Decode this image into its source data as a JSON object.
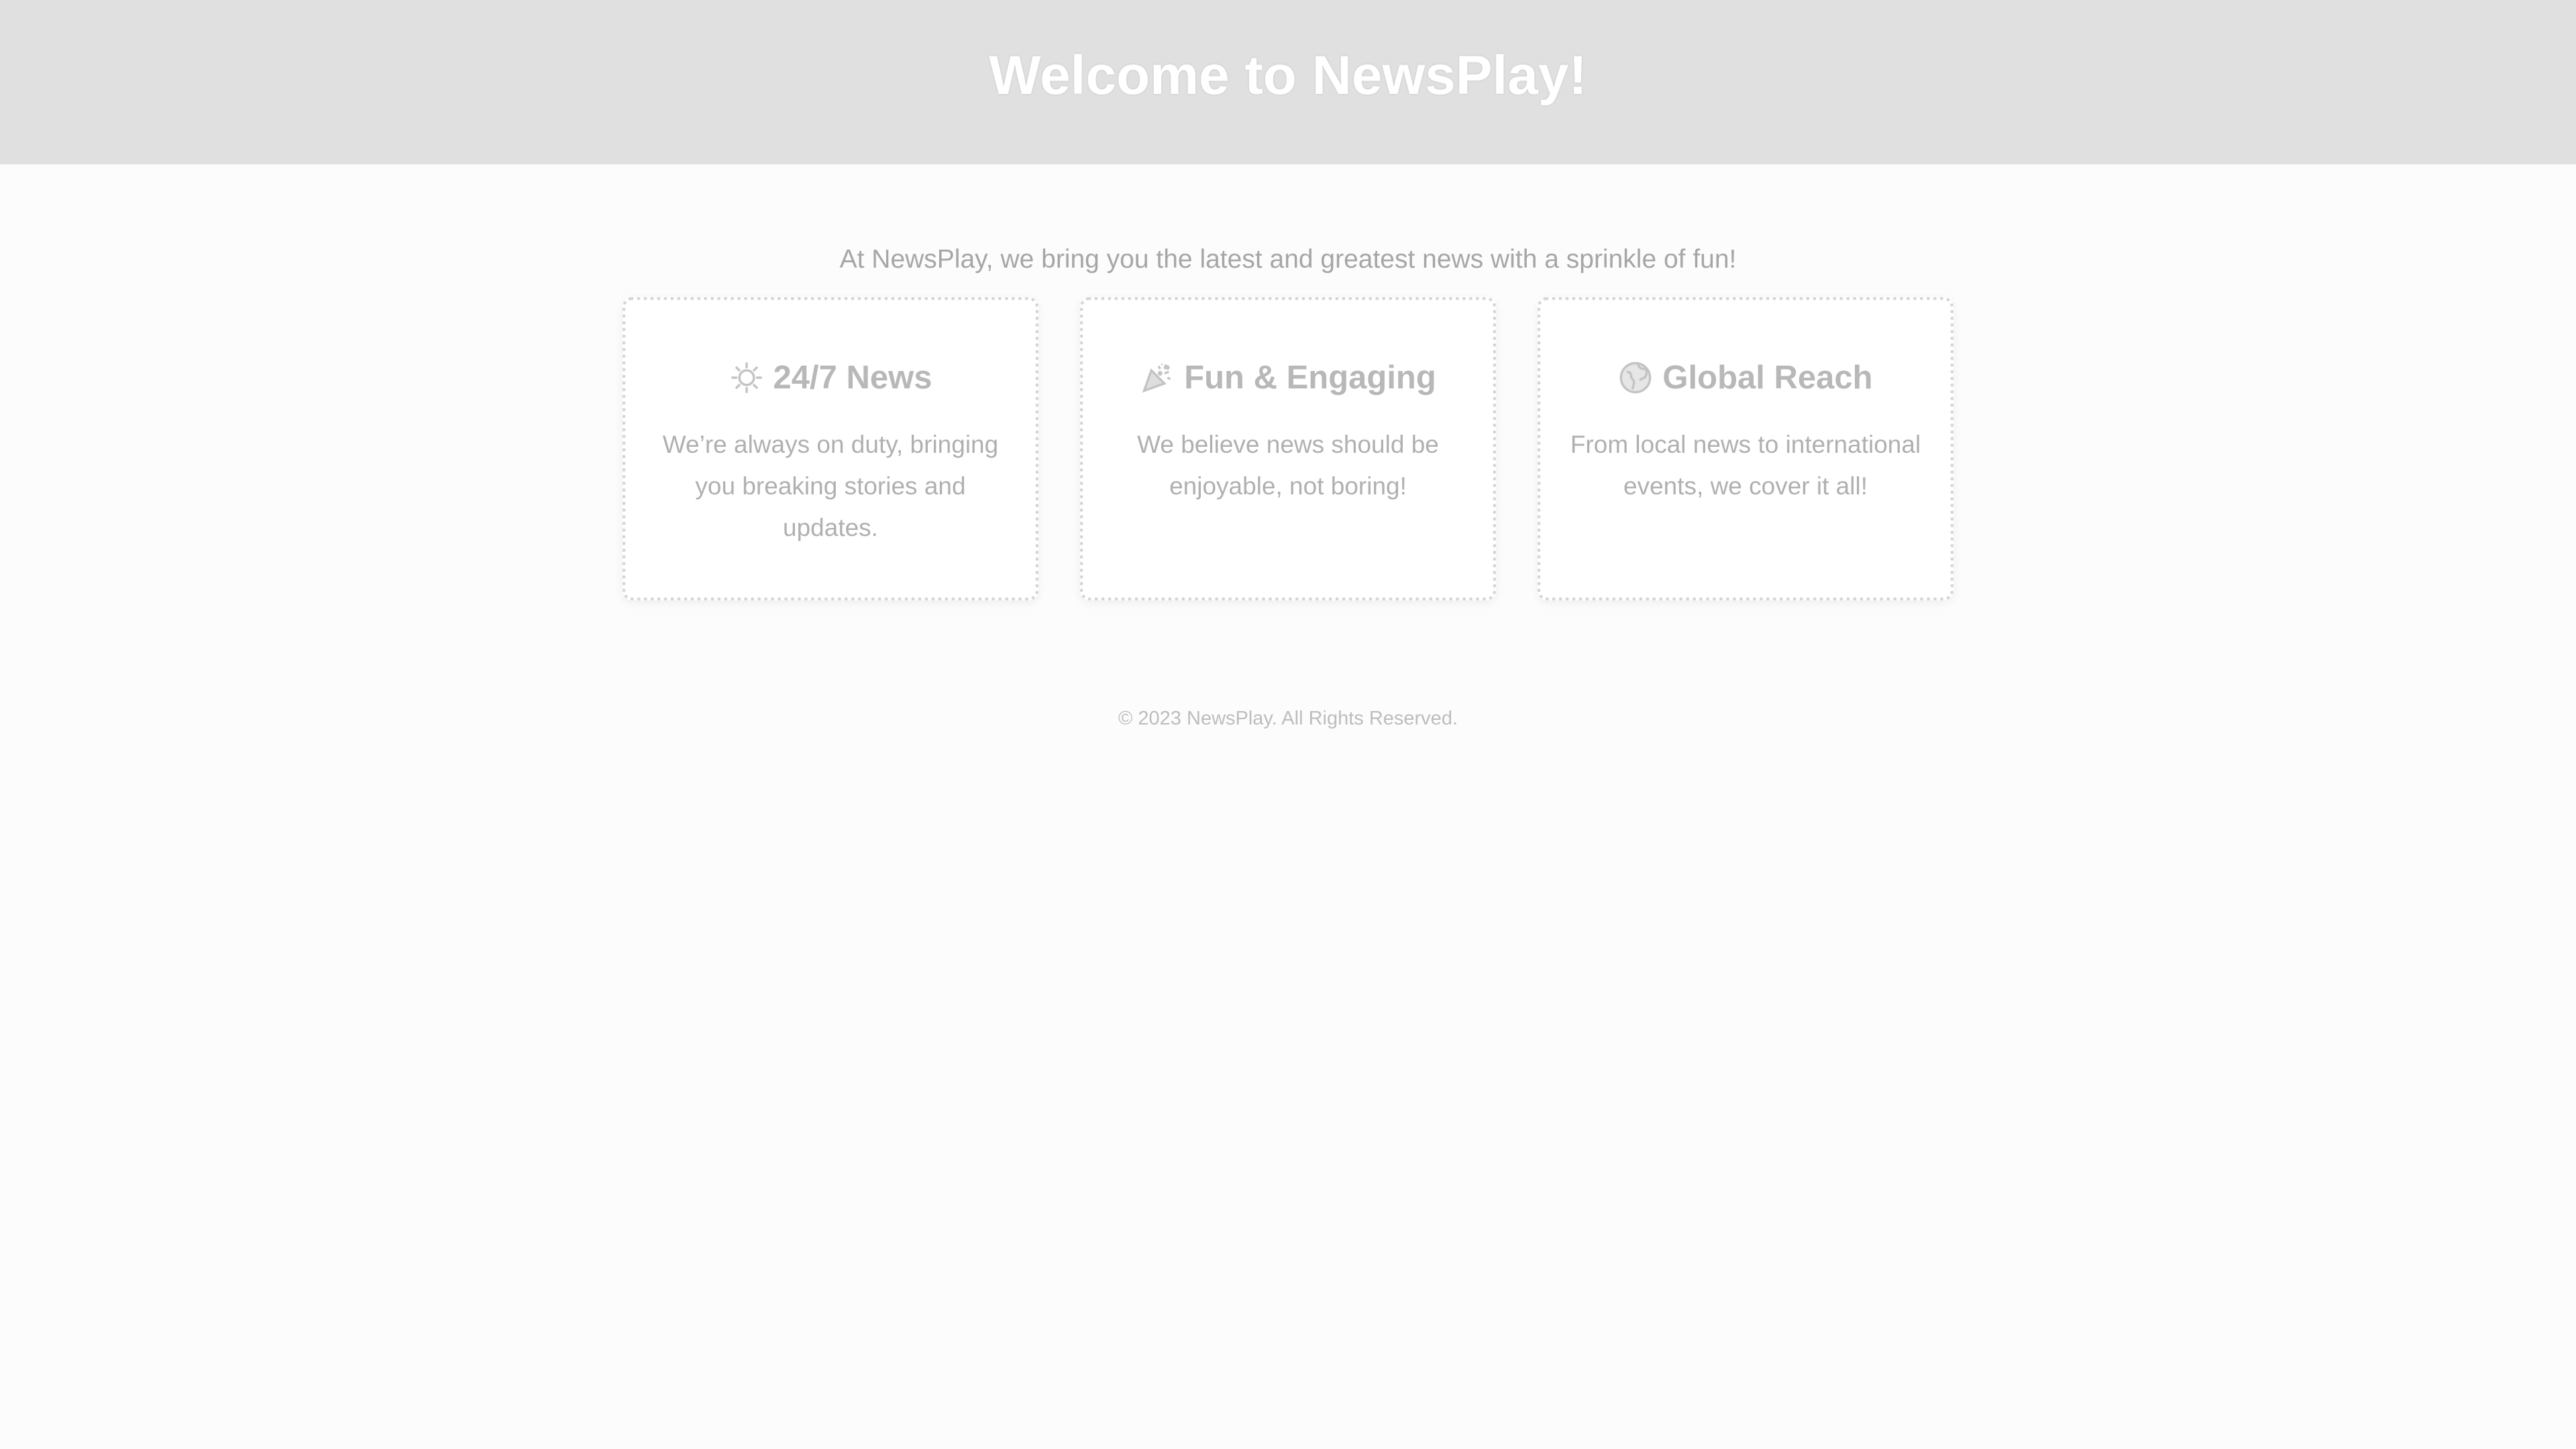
{
  "header": {
    "title": "Welcome to NewsPlay!",
    "background": "#e0e0e0"
  },
  "main": {
    "tagline": "At NewsPlay, we bring you the latest and greatest news with a sprinkle of fun!",
    "cards": [
      {
        "icon": "sun-burst-icon",
        "title": "24/7 News",
        "text": "We’re always on duty, bringing you breaking stories and updates."
      },
      {
        "icon": "party-popper-icon",
        "title": "Fun & Engaging",
        "text": "We believe news should be enjoyable, not boring!"
      },
      {
        "icon": "globe-icon",
        "title": "Global Reach",
        "text": "From local news to international events, we cover it all!"
      }
    ]
  },
  "footer": {
    "copyright": "© 2023 NewsPlay. All Rights Reserved."
  }
}
